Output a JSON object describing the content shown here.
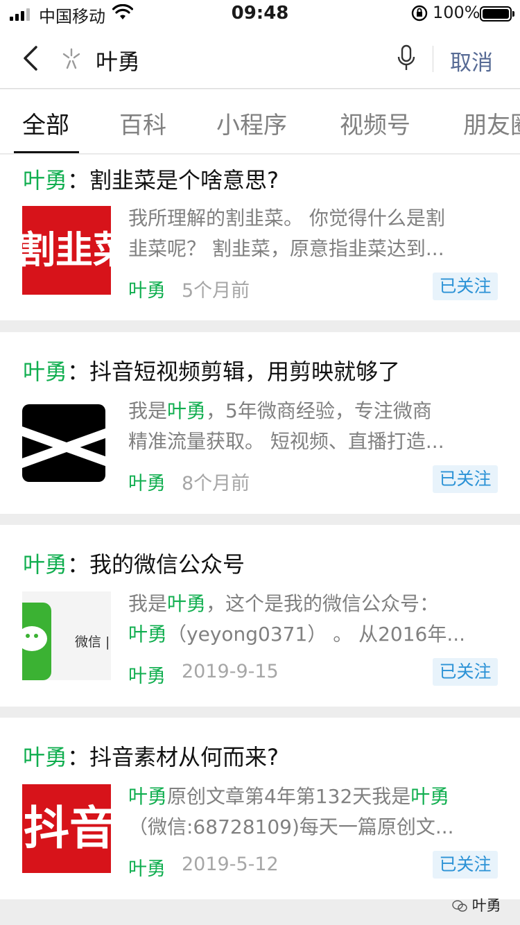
{
  "status_bar": {
    "carrier": "中国移动",
    "time": "09:48",
    "battery": "100%"
  },
  "search": {
    "query": "叶勇",
    "cancel_label": "取消"
  },
  "tabs": [
    {
      "label": "全部",
      "active": true
    },
    {
      "label": "百科",
      "active": false
    },
    {
      "label": "小程序",
      "active": false
    },
    {
      "label": "视频号",
      "active": false
    },
    {
      "label": "朋友圈",
      "active": false
    }
  ],
  "results": [
    {
      "keyword": "叶勇",
      "title": "：割韭菜是个啥意思?",
      "thumb_text": "割韭菜",
      "snippet_line1": "我所理解的割韭菜。 你觉得什么是割",
      "snippet_line2": "韭菜呢？ 割韭菜，原意指韭菜达到...",
      "source": "叶勇",
      "date": "5个月前",
      "follow_label": "已关注"
    },
    {
      "keyword": "叶勇",
      "title": "：抖音短视频剪辑，用剪映就够了",
      "snippet_line1_pre": "我是",
      "snippet_line1_hl": "叶勇",
      "snippet_line1_post": "，5年微商经验，专注微商",
      "snippet_line2": "精准流量获取。 短视频、直播打造...",
      "source": "叶勇",
      "date": "8个月前",
      "follow_label": "已关注"
    },
    {
      "keyword": "叶勇",
      "title": "：我的微信公众号",
      "thumb_text": "微信 |",
      "snippet_line1_pre": "我是",
      "snippet_line1_hl": "叶勇",
      "snippet_line1_post": "，这个是我的微信公众号：",
      "snippet_line2_hl": "叶勇",
      "snippet_line2_post": "（yeyong0371） 。 从2016年...",
      "source": "叶勇",
      "date": "2019-9-15",
      "follow_label": "已关注"
    },
    {
      "keyword": "叶勇",
      "title": "：抖音素材从何而来?",
      "thumb_text": "抖音",
      "snippet_line1_hl": "叶勇",
      "snippet_line1_mid": "原创文章第4年第132天我是",
      "snippet_line1_hl2": "叶勇",
      "snippet_line2": "（微信:68728109)每天一篇原创文...",
      "source": "叶勇",
      "date": "2019-5-12",
      "follow_label": "已关注"
    }
  ],
  "watermark": "叶勇",
  "colors": {
    "highlight": "#10ae4f",
    "link": "#576b95",
    "follow_bg": "#e8f3fb",
    "follow_text": "#2b92d6",
    "thumb_red": "#d7131a"
  }
}
